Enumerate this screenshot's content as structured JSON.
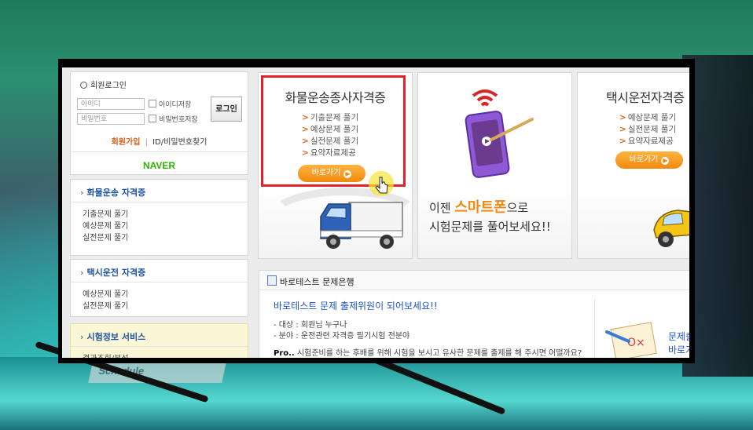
{
  "login": {
    "title": "회원로그인",
    "id_placeholder": "아이디",
    "pw_placeholder": "비밀번호",
    "save_id": "아이디저장",
    "save_pw": "비밀번호저장",
    "button": "로그인",
    "join": "회원가입",
    "separator": "|",
    "find": "ID/비밀번호찾기",
    "naver": "NAVER"
  },
  "menus": [
    {
      "title": "화물운송 자격증",
      "items": [
        "기출문제 풀기",
        "예상문제 풀기",
        "실전문제 풀기"
      ]
    },
    {
      "title": "택시운전 자격증",
      "items": [
        "예상문제 풀기",
        "실전문제 풀기"
      ]
    },
    {
      "title": "시험정보 서비스",
      "items": [
        "결과조회/분석"
      ]
    }
  ],
  "cards": [
    {
      "title": "화물운송종사자격증",
      "bullets": [
        "기출문제 풀기",
        "예상문제 풀기",
        "실전문제 풀기",
        "요약자료제공"
      ],
      "button": "바로가기"
    },
    {
      "line1_pre": "이젠 ",
      "line1_em": "스마트폰",
      "line1_post": "으로",
      "line2": "시험문제를 풀어보세요!!"
    },
    {
      "title": "택시운전자격증",
      "bullets": [
        "예상문제 풀기",
        "실전문제 풀기",
        "요약자료제공"
      ],
      "button": "바로가기"
    }
  ],
  "panel": {
    "header": "바로테스트 문제은행",
    "title": "바로테스트 문제 출제위원이 되어보세요!!",
    "lines": [
      "- 대상 : 회원님 누구나",
      "- 분야 : 운전관련 자격증 필기시험 전분야"
    ],
    "foot_label": "Pro..",
    "foot_text": " 시험준비를 하는 후배를 위해 시험을 보시고 유사한 문제를 출제를 해 주시면 어떨까요?",
    "right_line1": "문제출",
    "right_line2": "바로가"
  },
  "background": {
    "plate_text": "Schedule"
  },
  "colors": {
    "highlight": "#e0232b",
    "accent_orange": "#f08a10",
    "link_blue": "#1f55c8",
    "naver_green": "#2db400"
  }
}
